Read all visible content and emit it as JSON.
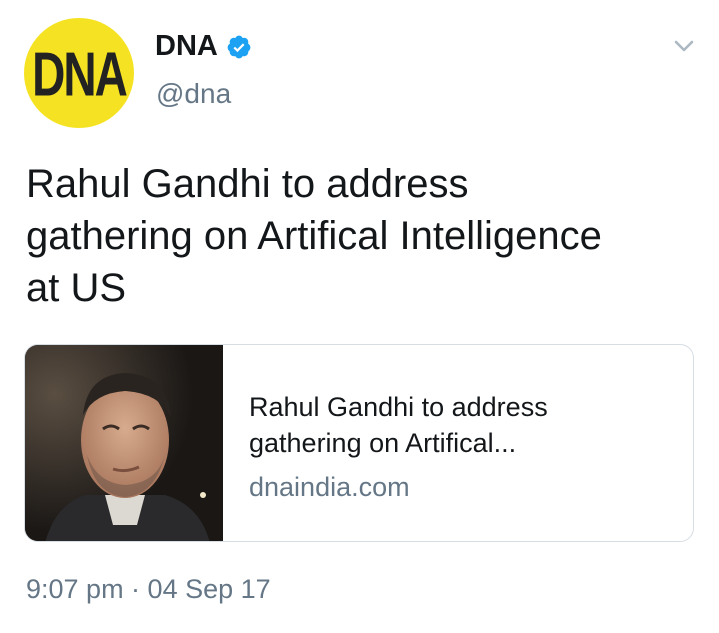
{
  "tweet": {
    "avatar_text": "DNA",
    "display_name": "DNA",
    "handle": "@dna",
    "verified": true,
    "text_lines": [
      "Rahul Gandhi to address",
      "gathering on Artifical Intelligence",
      "at US"
    ],
    "timestamp": "9:07 pm · 04 Sep 17"
  },
  "card": {
    "title_lines": [
      "Rahul Gandhi to address",
      "gathering on Artifical..."
    ],
    "domain": "dnaindia.com",
    "image_subject": "portrait-photo"
  },
  "colors": {
    "avatar_bg": "#f5e323",
    "verified_blue": "#1da1f2",
    "text_primary": "#14171a",
    "text_secondary": "#657786",
    "card_border": "#d6dde3"
  },
  "icons": {
    "verified": "verified-badge-icon",
    "more": "chevron-down-icon"
  }
}
